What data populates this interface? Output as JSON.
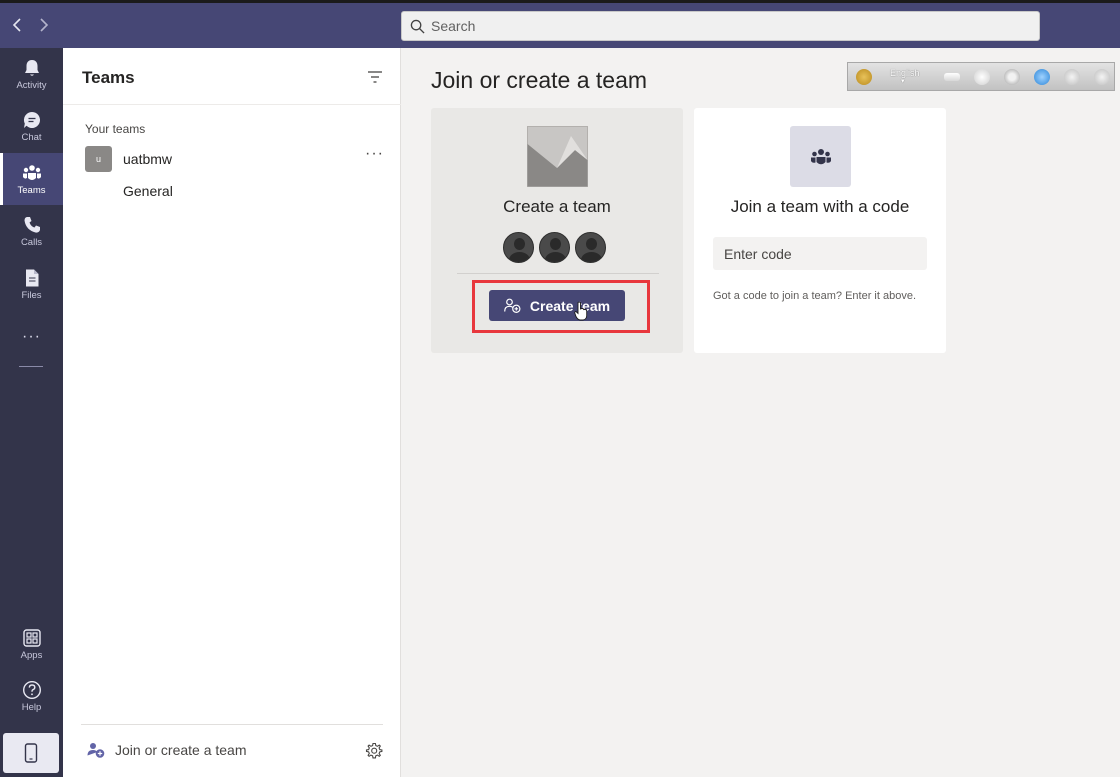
{
  "search": {
    "placeholder": "Search"
  },
  "rail": {
    "items": [
      {
        "label": "Activity",
        "icon": "bell-icon"
      },
      {
        "label": "Chat",
        "icon": "chat-icon"
      },
      {
        "label": "Teams",
        "icon": "teams-icon",
        "active": true
      },
      {
        "label": "Calls",
        "icon": "phone-icon"
      },
      {
        "label": "Files",
        "icon": "file-icon"
      }
    ],
    "more": "···",
    "bottom": [
      {
        "label": "Apps",
        "icon": "apps-icon"
      },
      {
        "label": "Help",
        "icon": "help-icon"
      }
    ]
  },
  "panel": {
    "title": "Teams",
    "section_label": "Your teams",
    "teams": [
      {
        "avatar": "u",
        "name": "uatbmw",
        "more": "···",
        "channels": [
          "General"
        ]
      }
    ],
    "footer": {
      "join_label": "Join or create a team"
    }
  },
  "main": {
    "title": "Join or create a team",
    "toolbar": {
      "language": "English"
    },
    "create_card": {
      "heading": "Create a team",
      "button_label": "Create team"
    },
    "join_card": {
      "heading": "Join a team with a code",
      "input_placeholder": "Enter code",
      "hint": "Got a code to join a team? Enter it above."
    }
  },
  "colors": {
    "top_bar": "#464775",
    "rail": "#33344a",
    "accent": "#464775",
    "highlight": "#e8373d",
    "canvas": "#f3f2f1"
  }
}
